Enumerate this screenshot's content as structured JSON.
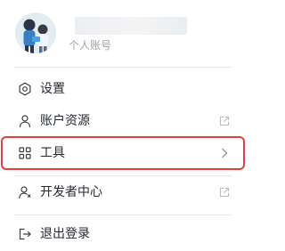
{
  "profile": {
    "account_label": "个人账号"
  },
  "menu": {
    "settings": {
      "label": "设置",
      "icon": "gear-icon"
    },
    "account_resources": {
      "label": "账户资源",
      "icon": "user-icon",
      "trail_icon": "external-link-icon"
    },
    "tools": {
      "label": "工具",
      "icon": "grid-icon",
      "trail_icon": "chevron-right-icon"
    },
    "developer_center": {
      "label": "开发者中心",
      "icon": "developer-user-icon",
      "trail_icon": "external-link-icon"
    },
    "logout": {
      "label": "退出登录",
      "icon": "logout-icon"
    }
  },
  "colors": {
    "highlight": "#e33f3f",
    "text": "#262a30",
    "muted": "#9ea3ab",
    "divider": "#e7e9ec"
  }
}
